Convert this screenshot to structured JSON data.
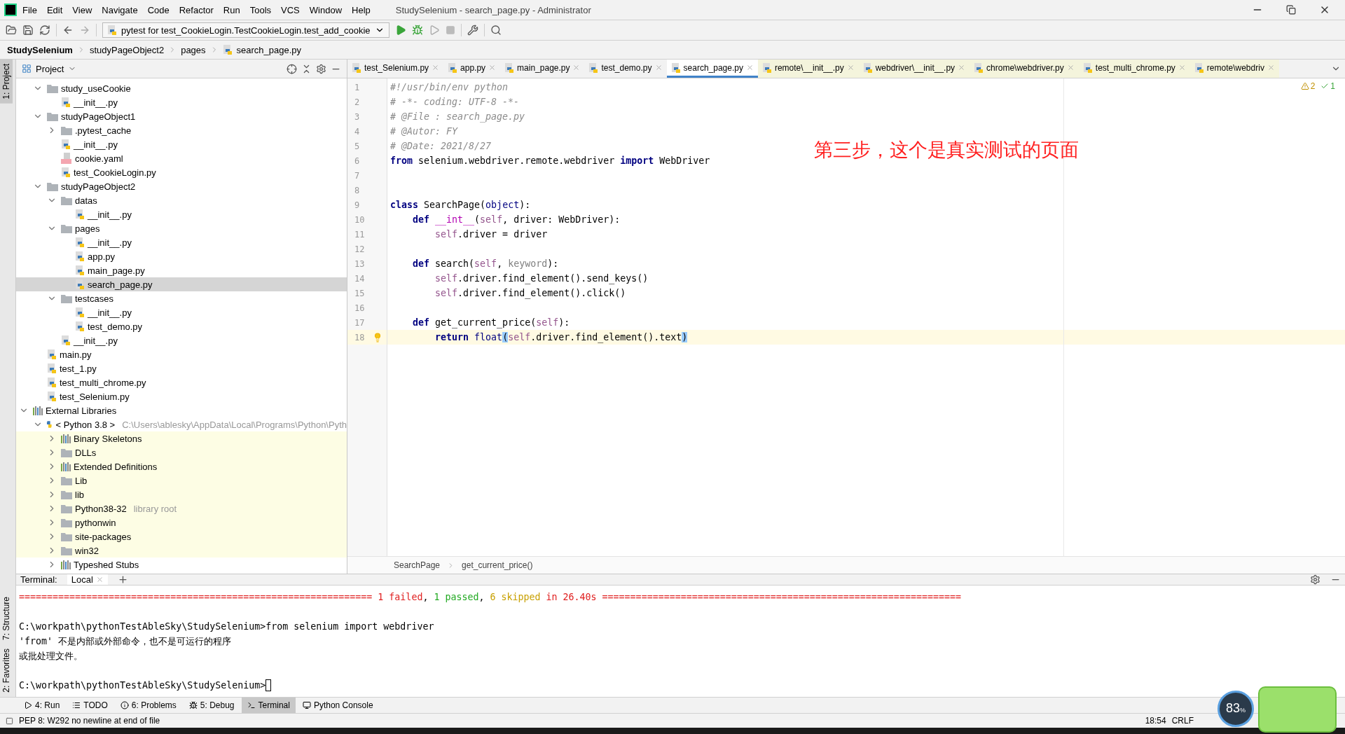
{
  "window": {
    "title": "StudySelenium - search_page.py - Administrator"
  },
  "menu": [
    "File",
    "Edit",
    "View",
    "Navigate",
    "Code",
    "Refactor",
    "Run",
    "Tools",
    "VCS",
    "Window",
    "Help"
  ],
  "toolbar": {
    "run_config": "pytest for test_CookieLogin.TestCookieLogin.test_add_cookie"
  },
  "breadcrumb": [
    "StudySelenium",
    "studyPageObject2",
    "pages",
    "search_page.py"
  ],
  "left_strip": {
    "top": [
      {
        "label": "1: Project",
        "selected": true
      }
    ],
    "bottom": [
      {
        "label": "7: Structure",
        "selected": false
      },
      {
        "label": "2: Favorites",
        "selected": false
      }
    ]
  },
  "project": {
    "title": "Project",
    "tree": [
      {
        "label": "study_useCookie",
        "kind": "folder",
        "expanded": true,
        "selected": false,
        "tinted": false,
        "children": [
          {
            "label": "__init__.py",
            "kind": "python",
            "selected": false,
            "tinted": false
          }
        ]
      },
      {
        "label": "studyPageObject1",
        "kind": "folder",
        "expanded": true,
        "selected": false,
        "tinted": false,
        "children": [
          {
            "label": ".pytest_cache",
            "kind": "folder",
            "expanded": false,
            "selected": false,
            "tinted": false
          },
          {
            "label": "__init__.py",
            "kind": "python",
            "selected": false,
            "tinted": false
          },
          {
            "label": "cookie.yaml",
            "kind": "yaml",
            "selected": false,
            "tinted": false
          },
          {
            "label": "test_CookieLogin.py",
            "kind": "python",
            "selected": false,
            "tinted": false
          }
        ]
      },
      {
        "label": "studyPageObject2",
        "kind": "folder",
        "expanded": true,
        "selected": false,
        "tinted": false,
        "children": [
          {
            "label": "datas",
            "kind": "folder",
            "expanded": true,
            "selected": false,
            "tinted": false,
            "children": [
              {
                "label": "__init__.py",
                "kind": "python",
                "selected": false,
                "tinted": false
              }
            ]
          },
          {
            "label": "pages",
            "kind": "folder",
            "expanded": true,
            "selected": false,
            "tinted": false,
            "children": [
              {
                "label": "__init__.py",
                "kind": "python",
                "selected": false,
                "tinted": false
              },
              {
                "label": "app.py",
                "kind": "python",
                "selected": false,
                "tinted": false
              },
              {
                "label": "main_page.py",
                "kind": "python",
                "selected": false,
                "tinted": false
              },
              {
                "label": "search_page.py",
                "kind": "python",
                "selected": true,
                "tinted": false
              }
            ]
          },
          {
            "label": "testcases",
            "kind": "folder",
            "expanded": true,
            "selected": false,
            "tinted": false,
            "children": [
              {
                "label": "__init__.py",
                "kind": "python",
                "selected": false,
                "tinted": false
              },
              {
                "label": "test_demo.py",
                "kind": "python",
                "selected": false,
                "tinted": false
              }
            ]
          },
          {
            "label": "__init__.py",
            "kind": "python",
            "selected": false,
            "tinted": false
          }
        ]
      },
      {
        "label": "main.py",
        "kind": "python",
        "selected": false,
        "tinted": false
      },
      {
        "label": "test_1.py",
        "kind": "python",
        "selected": false,
        "tinted": false
      },
      {
        "label": "test_multi_chrome.py",
        "kind": "python",
        "selected": false,
        "tinted": false
      },
      {
        "label": "test_Selenium.py",
        "kind": "python",
        "selected": false,
        "tinted": false
      }
    ],
    "external": {
      "label": "External Libraries",
      "kind": "library",
      "expanded": true,
      "selected": false,
      "tinted": false,
      "children": [
        {
          "label": "< Python 3.8 >",
          "hint": "C:\\Users\\ablesky\\AppData\\Local\\Programs\\Python\\Pyth",
          "kind": "sdk",
          "expanded": true,
          "selected": false,
          "tinted": false,
          "children": [
            {
              "label": "Binary Skeletons",
              "kind": "library",
              "expanded": false,
              "selected": false,
              "tinted": true
            },
            {
              "label": "DLLs",
              "kind": "folder",
              "expanded": false,
              "selected": false,
              "tinted": true
            },
            {
              "label": "Extended Definitions",
              "kind": "library",
              "expanded": false,
              "selected": false,
              "tinted": true
            },
            {
              "label": "Lib",
              "kind": "folder",
              "expanded": false,
              "selected": false,
              "tinted": true
            },
            {
              "label": "lib",
              "kind": "folder",
              "expanded": false,
              "selected": false,
              "tinted": true
            },
            {
              "label": "Python38-32",
              "hint": "library root",
              "kind": "folder",
              "expanded": false,
              "selected": false,
              "tinted": true
            },
            {
              "label": "pythonwin",
              "kind": "folder",
              "expanded": false,
              "selected": false,
              "tinted": true
            },
            {
              "label": "site-packages",
              "kind": "folder",
              "expanded": false,
              "selected": false,
              "tinted": true
            },
            {
              "label": "win32",
              "kind": "folder",
              "expanded": false,
              "selected": false,
              "tinted": true
            },
            {
              "label": "Typeshed Stubs",
              "kind": "library",
              "expanded": false,
              "selected": false,
              "tinted": false
            }
          ]
        }
      ]
    }
  },
  "tabs": [
    {
      "label": "test_Selenium.py",
      "selected": false,
      "external": false
    },
    {
      "label": "app.py",
      "selected": false,
      "external": false
    },
    {
      "label": "main_page.py",
      "selected": false,
      "external": false
    },
    {
      "label": "test_demo.py",
      "selected": false,
      "external": false
    },
    {
      "label": "search_page.py",
      "selected": true,
      "external": false
    },
    {
      "label": "remote\\__init__.py",
      "selected": false,
      "external": true
    },
    {
      "label": "webdriver\\__init__.py",
      "selected": false,
      "external": true
    },
    {
      "label": "chrome\\webdriver.py",
      "selected": false,
      "external": true
    },
    {
      "label": "test_multi_chrome.py",
      "selected": false,
      "external": true
    },
    {
      "label": "remote\\webdriv",
      "selected": false,
      "external": true
    }
  ],
  "inspections": {
    "warnings": "2",
    "ok": "1"
  },
  "code": [
    {
      "number": "1",
      "current": false,
      "segments": [
        {
          "text": "#!/usr/bin/env python",
          "kind": "comment"
        }
      ]
    },
    {
      "number": "2",
      "current": false,
      "segments": [
        {
          "text": "# -*- coding: UTF-8 -*-",
          "kind": "comment"
        }
      ]
    },
    {
      "number": "3",
      "current": false,
      "segments": [
        {
          "text": "# @File : search_page.py",
          "kind": "comment"
        }
      ]
    },
    {
      "number": "4",
      "current": false,
      "segments": [
        {
          "text": "# @Autor: FY",
          "kind": "comment"
        }
      ]
    },
    {
      "number": "5",
      "current": false,
      "segments": [
        {
          "text": "# @Date: 2021/8/27",
          "kind": "comment"
        }
      ]
    },
    {
      "number": "6",
      "current": false,
      "segments": [
        {
          "text": "from",
          "kind": "keyword"
        },
        {
          "text": " selenium.webdriver.remote.webdriver ",
          "kind": "plain"
        },
        {
          "text": "import",
          "kind": "keyword"
        },
        {
          "text": " WebDriver",
          "kind": "plain"
        }
      ]
    },
    {
      "number": "7",
      "current": false
    },
    {
      "number": "8",
      "current": false
    },
    {
      "number": "9",
      "current": false,
      "segments": [
        {
          "text": "class",
          "kind": "keyword"
        },
        {
          "text": " SearchPage(",
          "kind": "plain"
        },
        {
          "text": "object",
          "kind": "builtin"
        },
        {
          "text": "):",
          "kind": "plain"
        }
      ]
    },
    {
      "number": "10",
      "current": false,
      "segments": [
        {
          "text": "    def",
          "kind": "keyword"
        },
        {
          "text": " __int__",
          "kind": "magic"
        },
        {
          "text": "(",
          "kind": "plain"
        },
        {
          "text": "self",
          "kind": "self"
        },
        {
          "text": ", driver: WebDriver):",
          "kind": "plain"
        }
      ]
    },
    {
      "number": "11",
      "current": false,
      "segments": [
        {
          "text": "        self",
          "kind": "self"
        },
        {
          "text": ".driver = driver",
          "kind": "plain"
        }
      ]
    },
    {
      "number": "12",
      "current": false
    },
    {
      "number": "13",
      "current": false,
      "segments": [
        {
          "text": "    def",
          "kind": "keyword"
        },
        {
          "text": " search(",
          "kind": "plain"
        },
        {
          "text": "self",
          "kind": "self"
        },
        {
          "text": ", ",
          "kind": "plain"
        },
        {
          "text": "keyword",
          "kind": "unused"
        },
        {
          "text": "):",
          "kind": "plain"
        }
      ]
    },
    {
      "number": "14",
      "current": false,
      "segments": [
        {
          "text": "        self",
          "kind": "self"
        },
        {
          "text": ".driver.find_element().send_keys()",
          "kind": "plain"
        }
      ]
    },
    {
      "number": "15",
      "current": false,
      "segments": [
        {
          "text": "        self",
          "kind": "self"
        },
        {
          "text": ".driver.find_element().click()",
          "kind": "plain"
        }
      ]
    },
    {
      "number": "16",
      "current": false
    },
    {
      "number": "17",
      "current": false,
      "segments": [
        {
          "text": "    def",
          "kind": "keyword"
        },
        {
          "text": " get_current_price(",
          "kind": "plain"
        },
        {
          "text": "self",
          "kind": "self"
        },
        {
          "text": "):",
          "kind": "plain"
        }
      ]
    },
    {
      "number": "18",
      "current": true,
      "segments": [
        {
          "text": "        return",
          "kind": "keyword"
        },
        {
          "text": " float",
          "kind": "builtin"
        },
        {
          "text": "(",
          "kind": "match"
        },
        {
          "text": "self",
          "kind": "self"
        },
        {
          "text": ".driver.find_element().text",
          "kind": "plain"
        },
        {
          "text": ")",
          "kind": "match"
        }
      ]
    }
  ],
  "annotation": "第三步，这个是真实测试的页面",
  "editor_breadcrumb": [
    "SearchPage",
    "get_current_price()"
  ],
  "terminal": {
    "label": "Terminal:",
    "tabs": [
      {
        "label": "Local",
        "selected": true
      }
    ],
    "lines": [
      {
        "spaced": false,
        "cursor": false,
        "segments": [
          {
            "text": "=============================================================== 1 failed",
            "kind": "fail"
          },
          {
            "text": ", ",
            "kind": "plain"
          },
          {
            "text": "1 passed",
            "kind": "pass"
          },
          {
            "text": ", ",
            "kind": "plain"
          },
          {
            "text": "6 skipped",
            "kind": "skip"
          },
          {
            "text": " in 26.40s ================================================================",
            "kind": "fail"
          }
        ]
      },
      {
        "spaced": true,
        "cursor": false,
        "segments": [
          {
            "text": "C:\\workpath\\pythonTestAbleSky\\StudySelenium>from selenium import webdriver",
            "kind": "plain"
          }
        ]
      },
      {
        "spaced": false,
        "cursor": false,
        "segments": [
          {
            "text": "'from' 不是内部或外部命令，也不是可运行的程序",
            "kind": "plain"
          }
        ]
      },
      {
        "spaced": false,
        "cursor": false,
        "segments": [
          {
            "text": "或批处理文件。",
            "kind": "plain"
          }
        ]
      },
      {
        "spaced": true,
        "cursor": true,
        "segments": [
          {
            "text": "C:\\workpath\\pythonTestAbleSky\\StudySelenium>",
            "kind": "plain"
          }
        ]
      }
    ]
  },
  "tool_tabs": [
    {
      "label": "4: Run",
      "kind": "run",
      "selected": false
    },
    {
      "label": "TODO",
      "kind": "todo",
      "selected": false
    },
    {
      "label": "6: Problems",
      "kind": "problems",
      "selected": false
    },
    {
      "label": "5: Debug",
      "kind": "debug",
      "selected": false
    },
    {
      "label": "Terminal",
      "kind": "terminal",
      "selected": true
    },
    {
      "label": "Python Console",
      "kind": "console",
      "selected": false
    }
  ],
  "status_bar": {
    "message": "PEP 8: W292 no newline at end of file",
    "right": [
      "18:54",
      "CRLF"
    ]
  },
  "overlay_meter": {
    "reading": "83",
    "unit": "%"
  }
}
